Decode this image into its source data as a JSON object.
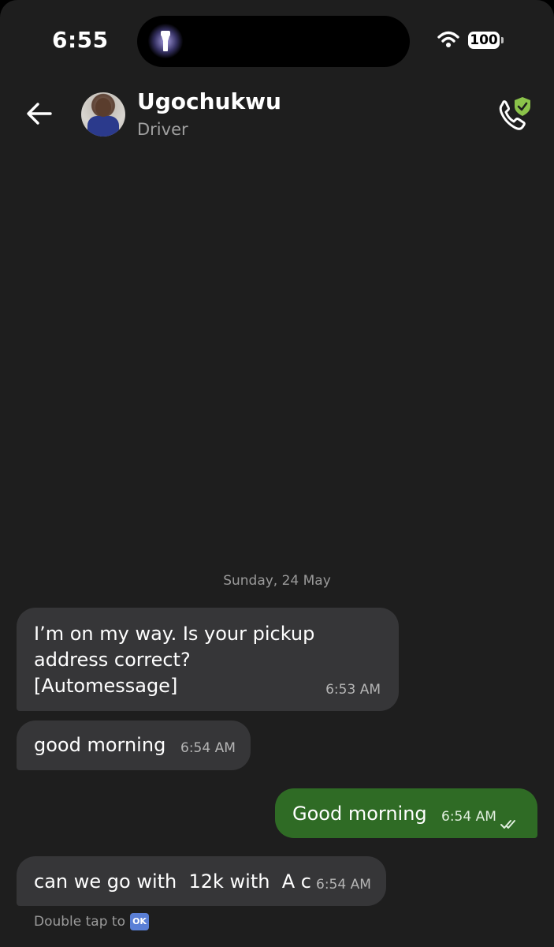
{
  "status_bar": {
    "time": "6:55",
    "battery": "100"
  },
  "header": {
    "contact_name": "Ugochukwu",
    "contact_role": "Driver"
  },
  "chat": {
    "date_separator": "Sunday, 24 May",
    "messages": [
      {
        "direction": "incoming",
        "text": "I’m on my way. Is your pickup address correct? [Automessage]",
        "time": "6:53 AM"
      },
      {
        "direction": "incoming",
        "text": "good morning",
        "time": "6:54 AM"
      },
      {
        "direction": "outgoing",
        "text": "Good morning",
        "time": "6:54 AM",
        "status": "read"
      },
      {
        "direction": "incoming",
        "text": "can we go with  12k with  A c",
        "time": "6:54 AM"
      }
    ],
    "hint_text": "Double tap to",
    "hint_emoji": "OK"
  },
  "colors": {
    "background": "#1e1e1e",
    "incoming_bubble": "#363638",
    "outgoing_bubble": "#2f6b25",
    "verified_shield": "#8bc34a"
  },
  "icons": [
    "flashlight-icon",
    "wifi-icon",
    "back-arrow-icon",
    "phone-shield-icon",
    "double-check-icon"
  ]
}
